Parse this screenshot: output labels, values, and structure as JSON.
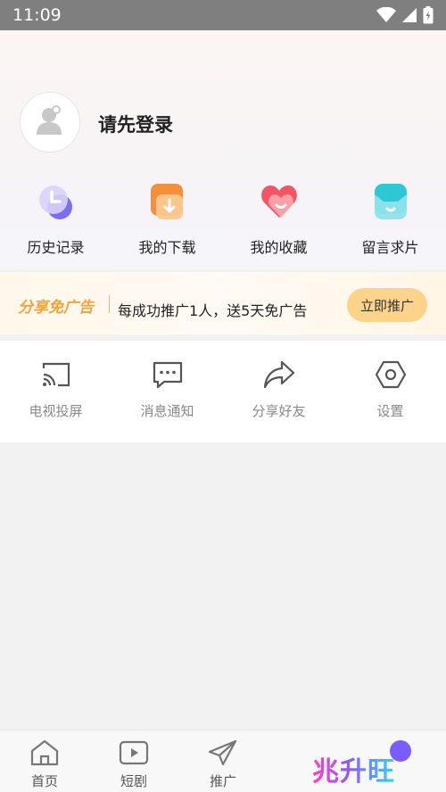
{
  "status_bar": {
    "time": "11:09",
    "icons": [
      "wifi-icon",
      "signal-icon",
      "battery-icon"
    ]
  },
  "profile": {
    "login_prompt": "请先登录"
  },
  "quick_actions": [
    {
      "label": "历史记录",
      "icon": "history-icon",
      "color": "#7b6cf0"
    },
    {
      "label": "我的下载",
      "icon": "download-icon",
      "color": "#f5903a"
    },
    {
      "label": "我的收藏",
      "icon": "favorite-icon",
      "color": "#f25563"
    },
    {
      "label": "留言求片",
      "icon": "message-icon",
      "color": "#2ec7d6"
    }
  ],
  "promo": {
    "title": "分享免广告",
    "description": "每成功推广1人，送5天免广告",
    "button_label": "立即推广",
    "accent_color": "#f2a33c"
  },
  "tools": [
    {
      "label": "电视投屏",
      "icon": "cast-icon"
    },
    {
      "label": "消息通知",
      "icon": "message-bubble-icon"
    },
    {
      "label": "分享好友",
      "icon": "share-icon"
    },
    {
      "label": "设置",
      "icon": "settings-icon"
    }
  ],
  "bottom_nav": [
    {
      "label": "首页",
      "icon": "home-icon"
    },
    {
      "label": "短剧",
      "icon": "play-icon"
    },
    {
      "label": "推广",
      "icon": "send-icon"
    }
  ],
  "watermark": {
    "text": "兆升旺"
  }
}
